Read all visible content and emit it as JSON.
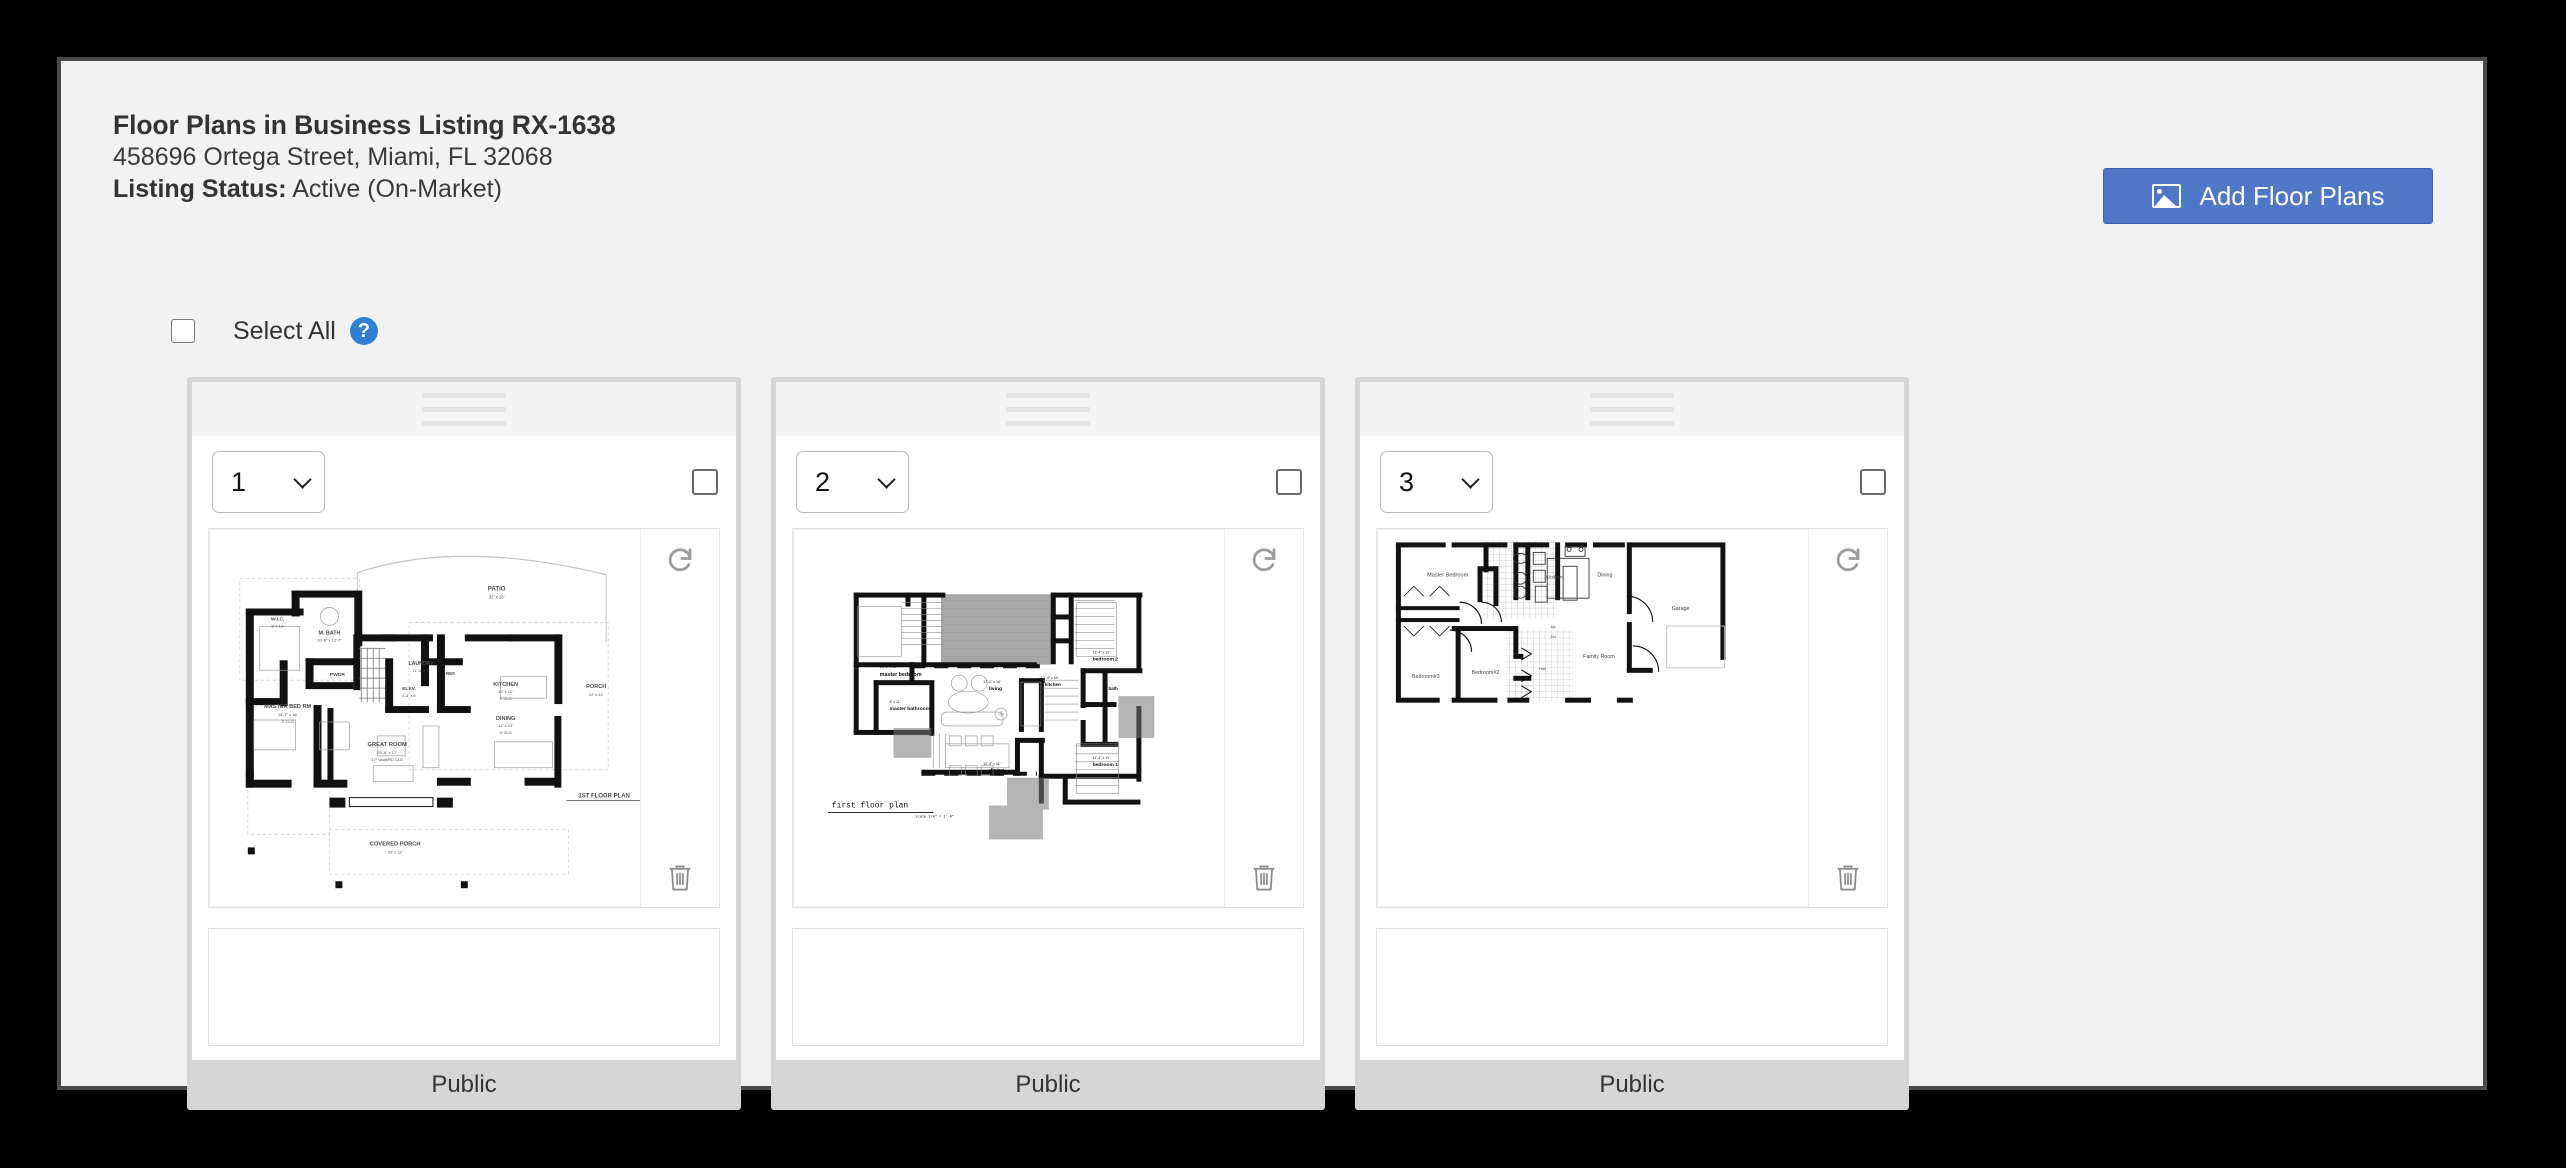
{
  "header": {
    "title": "Floor Plans in Business Listing RX-1638",
    "address": "458696 Ortega Street, Miami, FL 32068",
    "status_label": "Listing Status:",
    "status_value": "Active (On-Market)"
  },
  "toolbar": {
    "add_button_label": "Add Floor Plans",
    "add_button_icon": "picture-icon",
    "add_button_color": "#4e77c8"
  },
  "select_all": {
    "label": "Select All",
    "checked": false,
    "help_icon": "question-circle-icon",
    "help_icon_color": "#2f7fd4"
  },
  "cards": [
    {
      "order_value": "1",
      "order_options": [
        "1",
        "2",
        "3"
      ],
      "selected": false,
      "caption": "",
      "visibility": "Public",
      "rotate_icon": "rotate-cw-icon",
      "delete_icon": "trash-icon",
      "drag_handle_icon": "drag-handle-icon",
      "image_alt": "1ST FLOOR PLAN",
      "image_labels": [
        "PATIO",
        "MASTER BED RM",
        "M. BATH",
        "W.I.C.",
        "PWDR",
        "LAUNDRY",
        "ELEV.",
        "REF.",
        "KITCHEN",
        "DINING",
        "GREAT ROOM",
        "PORCH",
        "COVERED PORCH",
        "1ST FLOOR PLAN"
      ]
    },
    {
      "order_value": "2",
      "order_options": [
        "1",
        "2",
        "3"
      ],
      "selected": false,
      "caption": "",
      "visibility": "Public",
      "rotate_icon": "rotate-cw-icon",
      "delete_icon": "trash-icon",
      "drag_handle_icon": "drag-handle-icon",
      "image_alt": "first floor plan",
      "image_labels": [
        "master bedroom",
        "master bathroom",
        "living",
        "dining",
        "kitchen",
        "bath",
        "bedroom 1",
        "bedroom 2",
        "first floor plan"
      ]
    },
    {
      "order_value": "3",
      "order_options": [
        "1",
        "2",
        "3"
      ],
      "selected": false,
      "caption": "",
      "visibility": "Public",
      "rotate_icon": "rotate-cw-icon",
      "delete_icon": "trash-icon",
      "drag_handle_icon": "drag-handle-icon",
      "image_alt": "Floor plan with garage",
      "image_labels": [
        "Master Bedroom",
        "Bedroom#2",
        "Bedroom#3",
        "Kitchen",
        "Dining",
        "Family Room",
        "Garage"
      ]
    }
  ]
}
